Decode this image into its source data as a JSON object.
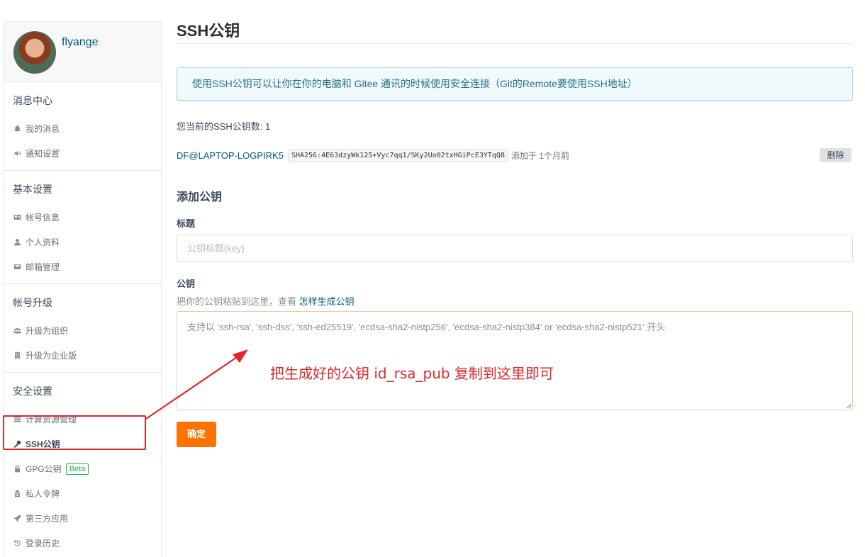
{
  "user": {
    "name": "flyange"
  },
  "sidebar": {
    "sections": [
      {
        "title": "消息中心",
        "items": [
          {
            "label": "我的消息",
            "icon": "bell-icon"
          },
          {
            "label": "通知设置",
            "icon": "volume-icon"
          }
        ]
      },
      {
        "title": "基本设置",
        "items": [
          {
            "label": "帐号信息",
            "icon": "id-card-icon"
          },
          {
            "label": "个人资料",
            "icon": "user-icon"
          },
          {
            "label": "邮箱管理",
            "icon": "envelope-icon"
          }
        ]
      },
      {
        "title": "帐号升级",
        "items": [
          {
            "label": "升级为组织",
            "icon": "users-icon"
          },
          {
            "label": "升级为企业版",
            "icon": "building-icon"
          }
        ]
      },
      {
        "title": "安全设置",
        "items": [
          {
            "label": "计算资源管理",
            "icon": "server-icon"
          },
          {
            "label": "SSH公钥",
            "icon": "key-icon",
            "active": true
          },
          {
            "label": "GPG公钥",
            "icon": "lock-icon",
            "badge": "Beta"
          },
          {
            "label": "私人令牌",
            "icon": "token-icon"
          },
          {
            "label": "第三方应用",
            "icon": "rocket-icon"
          },
          {
            "label": "登录历史",
            "icon": "history-icon"
          }
        ]
      }
    ]
  },
  "main": {
    "title": "SSH公钥",
    "info": "使用SSH公钥可以让你在你的电脑和 Gitee 通讯的时候使用安全连接（Git的Remote要使用SSH地址）",
    "key_count_text": "您当前的SSH公钥数: 1",
    "key": {
      "name": "DF@LAPTOP-LOGPIRK5",
      "fingerprint": "SHA256:4E63dzyWk125+Vyc7qq1/SKy2Uo02txHGiPcE3YTqQ8",
      "added": "添加于 1个月前",
      "delete_label": "删除"
    },
    "add_title": "添加公钥",
    "title_label": "标题",
    "title_placeholder": "公钥标题(key)",
    "key_label": "公钥",
    "hint_text": "把你的公钥粘贴到这里，查看",
    "hint_link": "怎样生成公钥",
    "key_placeholder": "支持以 'ssh-rsa', 'ssh-dss', 'ssh-ed25519', 'ecdsa-sha2-nistp256', 'ecdsa-sha2-nistp384' or 'ecdsa-sha2-nistp521' 开头",
    "submit_label": "确定"
  },
  "annotation": {
    "text": "把生成好的公钥 id_rsa_pub 复制到这里即可",
    "color": "#e3262a"
  },
  "colors": {
    "accent": "#fe7300",
    "link": "#005980",
    "info_bg": "#f0fafd"
  }
}
